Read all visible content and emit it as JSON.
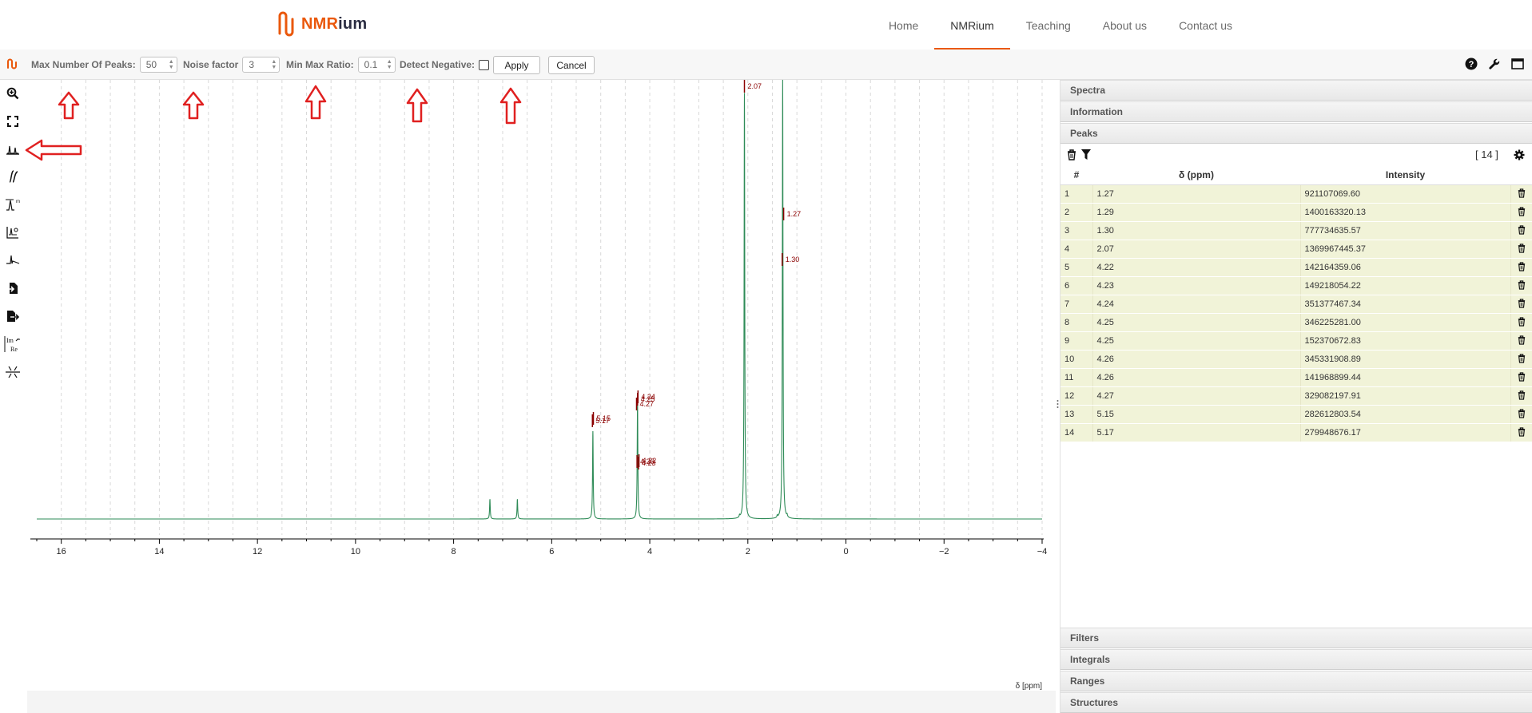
{
  "nav": {
    "brand_part1": "NMR",
    "brand_part2": "ium",
    "links": [
      "Home",
      "NMRium",
      "Teaching",
      "About us",
      "Contact us"
    ],
    "active": "NMRium"
  },
  "toolbar": {
    "max_peaks_label": "Max Number Of Peaks:",
    "max_peaks_value": "50",
    "noise_label": "Noise factor",
    "noise_value": "3",
    "minmax_label": "Min Max Ratio:",
    "minmax_value": "0.1",
    "detect_negative_label": "Detect Negative:",
    "detect_negative_checked": false,
    "apply_label": "Apply",
    "cancel_label": "Cancel"
  },
  "tools": [
    "zoom-icon",
    "fullscreen-icon",
    "peak-picking-icon",
    "integral-icon",
    "range-picking-icon",
    "baseline-icon",
    "phase-correction-icon",
    "import-icon",
    "export-icon",
    "real-imaginary-icon",
    "multiplet-analysis-icon"
  ],
  "panels": {
    "top": [
      "Spectra",
      "Information",
      "Peaks"
    ],
    "bottom": [
      "Filters",
      "Integrals",
      "Ranges",
      "Structures"
    ]
  },
  "peaks_table": {
    "count_label": "[ 14 ]",
    "columns": [
      "#",
      "δ (ppm)",
      "Intensity"
    ],
    "rows": [
      [
        "1",
        "1.27",
        "921107069.60"
      ],
      [
        "2",
        "1.29",
        "1400163320.13"
      ],
      [
        "3",
        "1.30",
        "777734635.57"
      ],
      [
        "4",
        "2.07",
        "1369967445.37"
      ],
      [
        "5",
        "4.22",
        "142164359.06"
      ],
      [
        "6",
        "4.23",
        "149218054.22"
      ],
      [
        "7",
        "4.24",
        "351377467.34"
      ],
      [
        "8",
        "4.25",
        "346225281.00"
      ],
      [
        "9",
        "4.25",
        "152370672.83"
      ],
      [
        "10",
        "4.26",
        "345331908.89"
      ],
      [
        "11",
        "4.26",
        "141968899.44"
      ],
      [
        "12",
        "4.27",
        "329082197.91"
      ],
      [
        "13",
        "5.15",
        "282612803.54"
      ],
      [
        "14",
        "5.17",
        "279948676.17"
      ]
    ]
  },
  "chart_data": {
    "type": "line",
    "xlabel": "δ [ppm]",
    "xlim": [
      16.5,
      -4
    ],
    "x_reversed": true,
    "x_ticks": [
      16,
      14,
      12,
      10,
      8,
      6,
      4,
      2,
      0,
      -2,
      -4
    ],
    "x_tick_labels": [
      "16",
      "14",
      "12",
      "10",
      "8",
      "6",
      "4",
      "2",
      "0",
      "−2",
      "−4"
    ],
    "series": [
      {
        "color": "#2e8b57",
        "peaks": [
          {
            "x": 7.26,
            "height": 0.045
          },
          {
            "x": 6.7,
            "height": 0.045
          },
          {
            "x": 5.16,
            "height": 0.2
          },
          {
            "x": 4.25,
            "height": 0.27
          },
          {
            "x": 2.17,
            "height": 0.005
          },
          {
            "x": 2.07,
            "height": 0.97
          },
          {
            "x": 1.4,
            "height": 0.005
          },
          {
            "x": 1.29,
            "height": 1.0
          },
          {
            "x": 1.2,
            "height": 0.005
          }
        ]
      }
    ],
    "peak_annotations": [
      {
        "x": 2.07,
        "label": "2.07"
      },
      {
        "x": 1.27,
        "label": "1.27"
      },
      {
        "x": 1.3,
        "label": "1.30"
      },
      {
        "x": 5.15,
        "label": "5.15"
      },
      {
        "x": 5.17,
        "label": "5.17"
      },
      {
        "x": 4.24,
        "label": "4.24"
      },
      {
        "x": 4.25,
        "label": "4.25"
      },
      {
        "x": 4.27,
        "label": "4.27"
      },
      {
        "x": 4.22,
        "label": "4.22"
      },
      {
        "x": 4.23,
        "label": "4.23"
      },
      {
        "x": 4.26,
        "label": "4.26"
      }
    ],
    "grid": true
  },
  "colors": {
    "accent": "#ea580c",
    "spectrum": "#2e8b57",
    "peak_label": "#8b0000",
    "annotation_arrow": "#e02020",
    "row_bg": "#f1f3d8"
  }
}
